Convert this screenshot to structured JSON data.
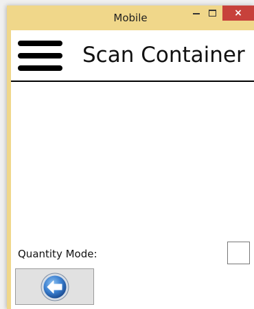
{
  "window": {
    "title": "Mobile",
    "minimize_icon": "minimize-icon",
    "maximize_icon": "maximize-icon",
    "close_icon": "close-icon",
    "close_glyph": "×"
  },
  "header": {
    "menu_icon": "hamburger-menu-icon",
    "title": "Scan Container"
  },
  "form": {
    "quantity_mode_label": "Quantity Mode:",
    "quantity_mode_checked": false
  },
  "footer": {
    "back_icon": "back-arrow-icon"
  },
  "colors": {
    "window_frame": "#f0d78a",
    "close_button": "#c7413b",
    "back_icon_blue": "#2f72c4"
  }
}
